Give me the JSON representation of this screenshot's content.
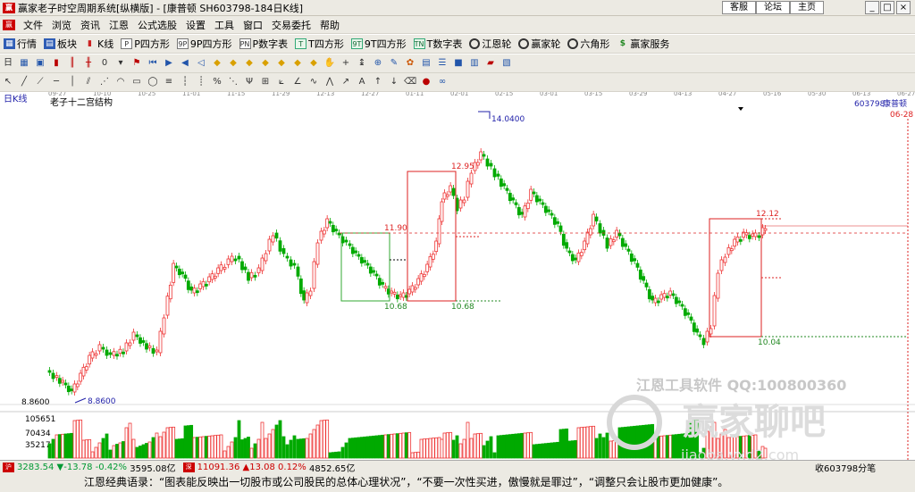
{
  "window": {
    "app_icon": "ying-logo-icon",
    "title": "赢家老子时空周期系统[纵横版] - [康普顿  SH603798-184日K线]",
    "links": [
      "客服",
      "论坛",
      "主页"
    ],
    "buttons": [
      "_",
      "□",
      "×"
    ]
  },
  "menu": [
    "文件",
    "浏览",
    "资讯",
    "江恩",
    "公式选股",
    "设置",
    "工具",
    "窗口",
    "交易委托",
    "帮助"
  ],
  "mdi_buttons": [
    "_",
    "□",
    "×"
  ],
  "toolbar1": [
    {
      "icon": "table-icon",
      "label": "行情"
    },
    {
      "icon": "board-icon",
      "label": "板块"
    },
    {
      "icon": "kline-icon",
      "label": "K线"
    },
    {
      "icon": "p-square-icon",
      "label": "P四方形"
    },
    {
      "icon": "9p-square-icon",
      "label": "9P四方形"
    },
    {
      "icon": "p-table-icon",
      "label": "P数字表"
    },
    {
      "icon": "t-square-icon",
      "label": "T四方形"
    },
    {
      "icon": "9t-square-icon",
      "label": "9T四方形"
    },
    {
      "icon": "t-table-icon",
      "label": "T数字表"
    },
    {
      "icon": "gann-wheel-icon",
      "label": "江恩轮"
    },
    {
      "icon": "ying-wheel-icon",
      "label": "赢家轮"
    },
    {
      "icon": "hexagon-icon",
      "label": "六角形"
    },
    {
      "icon": "dollar-icon",
      "label": "赢家服务"
    }
  ],
  "chart": {
    "period_label": "日K线",
    "structure_label": "老子十二宫结构",
    "code": "603798",
    "name": "康普顿",
    "date_axis": [
      "09-27",
      "10-10",
      "10-25",
      "11-01",
      "11-15",
      "11-29",
      "12-13",
      "12-27",
      "01-11",
      "02-01",
      "02-15",
      "03-01",
      "03-15",
      "03-29",
      "04-13",
      "04-27",
      "05-16",
      "05-30",
      "06-13",
      "06-27"
    ],
    "right_date": "06-28",
    "annotations": {
      "peak": "14.0400",
      "low": "8.8600",
      "box1_top": "11.90",
      "box1_bottom": "10.68",
      "box2_top": "12.95",
      "box2_bottom": "10.68",
      "box3_top": "12.12",
      "box3_bottom": "10.04",
      "left_axis_price": "8.8600"
    },
    "volume_axis": [
      "105651",
      "70434",
      "35217"
    ],
    "watermark_line1": "江恩工具软件  QQ:100800360",
    "watermark_line2": "赢家聊吧",
    "watermark_line3": "jiaoba.vxd2.com",
    "colors": {
      "up": "#e33",
      "down": "#0a0",
      "box": "#d22",
      "box_green": "#3a3",
      "dash": "#d22",
      "label_blue": "#22a",
      "label_green": "#282"
    }
  },
  "status": {
    "sh_index": "3283.54",
    "sh_change": "▼-13.78",
    "sh_pct": "-0.42%",
    "sh_amount": "3595.08亿",
    "sz_index": "11091.36",
    "sz_change": "▲13.08",
    "sz_pct": "0.12%",
    "sz_amount": "4852.65亿",
    "right_text": "收603798分笔"
  },
  "quote": "江恩经典语录：“图表能反映出一切股市或公司股民的总体心理状况”，“不要一次性买进，傲慢就是罪过”，“调整只会让股市更加健康”。"
}
